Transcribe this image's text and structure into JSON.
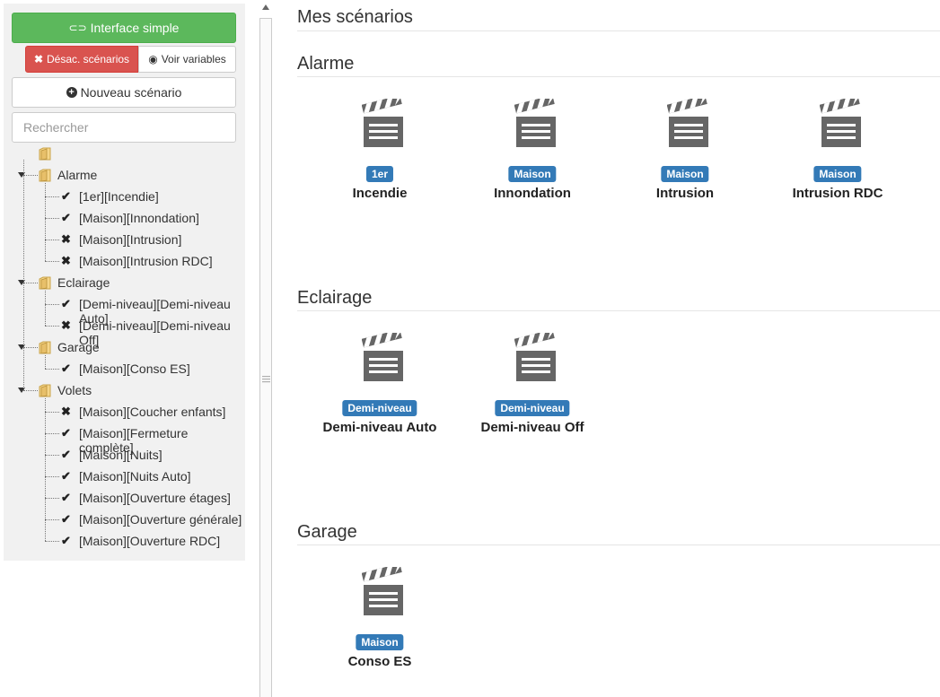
{
  "sidebar": {
    "simple_button": "Interface simple",
    "disable_button": "Désac. scénarios",
    "variables_button": "Voir variables",
    "new_button": "Nouveau scénario",
    "search_placeholder": "Rechercher",
    "groups": [
      {
        "label": "Alarme",
        "items": [
          {
            "label": "[1er][Incendie]",
            "enabled": true
          },
          {
            "label": "[Maison][Innondation]",
            "enabled": true
          },
          {
            "label": "[Maison][Intrusion]",
            "enabled": false
          },
          {
            "label": "[Maison][Intrusion RDC]",
            "enabled": false
          }
        ]
      },
      {
        "label": "Eclairage",
        "items": [
          {
            "label": "[Demi-niveau][Demi-niveau Auto]",
            "enabled": true
          },
          {
            "label": "[Demi-niveau][Demi-niveau Off]",
            "enabled": false
          }
        ]
      },
      {
        "label": "Garage",
        "items": [
          {
            "label": "[Maison][Conso ES]",
            "enabled": true
          }
        ]
      },
      {
        "label": "Volets",
        "items": [
          {
            "label": "[Maison][Coucher enfants]",
            "enabled": false
          },
          {
            "label": "[Maison][Fermeture complète]",
            "enabled": true
          },
          {
            "label": "[Maison][Nuits]",
            "enabled": true
          },
          {
            "label": "[Maison][Nuits Auto]",
            "enabled": true
          },
          {
            "label": "[Maison][Ouverture étages]",
            "enabled": true
          },
          {
            "label": "[Maison][Ouverture générale]",
            "enabled": true
          },
          {
            "label": "[Maison][Ouverture RDC]",
            "enabled": true
          }
        ]
      }
    ]
  },
  "main": {
    "title": "Mes scénarios",
    "sections": [
      {
        "title": "Alarme",
        "cards": [
          {
            "badge": "1er",
            "name": "Incendie"
          },
          {
            "badge": "Maison",
            "name": "Innondation"
          },
          {
            "badge": "Maison",
            "name": "Intrusion"
          },
          {
            "badge": "Maison",
            "name": "Intrusion RDC"
          }
        ]
      },
      {
        "title": "Eclairage",
        "cards": [
          {
            "badge": "Demi-niveau",
            "name": "Demi-niveau Auto"
          },
          {
            "badge": "Demi-niveau",
            "name": "Demi-niveau Off"
          }
        ]
      },
      {
        "title": "Garage",
        "cards": [
          {
            "badge": "Maison",
            "name": "Conso ES"
          }
        ]
      }
    ]
  },
  "colors": {
    "success": "#5cb85c",
    "danger": "#d9534f",
    "primary_badge": "#337ab7"
  }
}
